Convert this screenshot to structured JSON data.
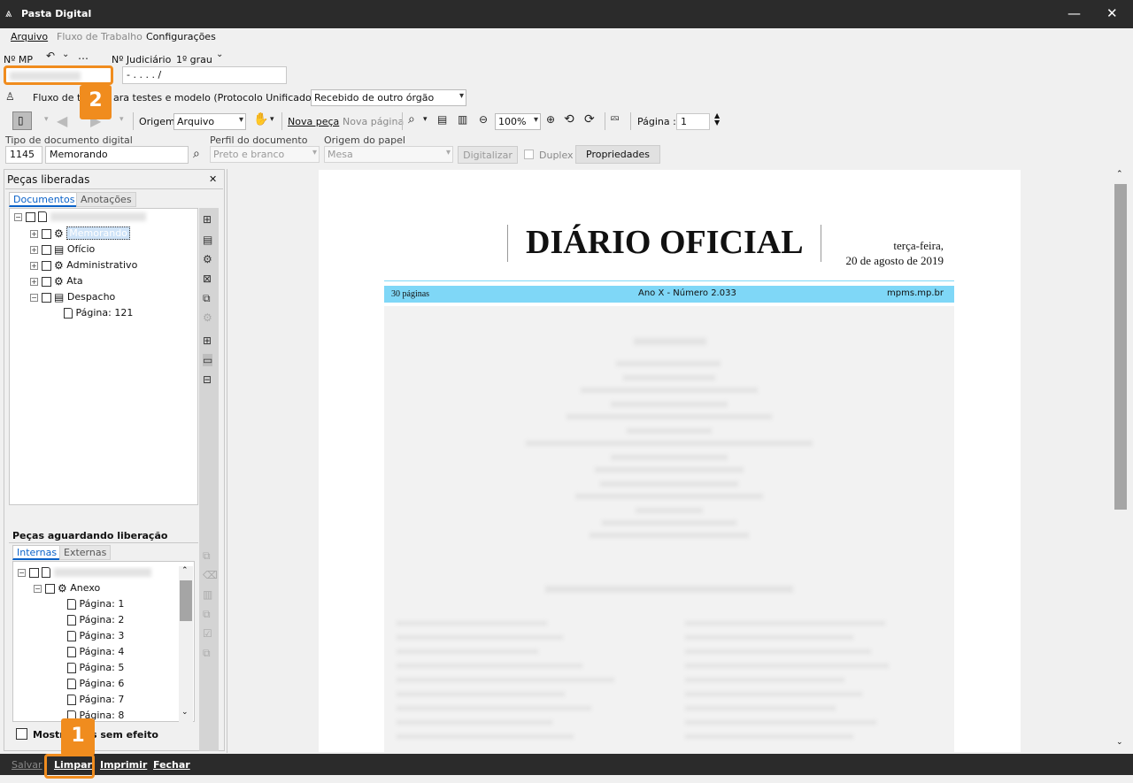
{
  "window": {
    "title": "Pasta Digital",
    "minimize": "—",
    "close": "✕"
  },
  "menu": {
    "arquivo": "Arquivo",
    "fluxo": "Fluxo de Trabalho",
    "config": "Configurações"
  },
  "header": {
    "nmp_label": "Nº MP",
    "judicial_label": "Nº Judiciário",
    "grau": "1º grau",
    "judicial_value": "-  .    .  .  .    /",
    "workflow_label": "Fluxo de tra",
    "workflow_text": "ara testes e modelo (Protocolo Unificado) - Fila",
    "fila_value": "Recebido de outro órgão"
  },
  "toolbar": {
    "origem_label": "Origem",
    "origem_value": "Arquivo",
    "nova_peca": "Nova peça",
    "nova_pagina": "Nova página",
    "zoom": "100%",
    "pagina_label": "Página :",
    "pagina_value": "1"
  },
  "docfields": {
    "tipo_label": "Tipo de documento digital",
    "tipo_code": "1145",
    "tipo_value": "Memorando",
    "perfil_label": "Perfil do documento",
    "perfil_value": "Preto e branco",
    "origem_papel_label": "Origem do papel",
    "origem_papel_value": "Mesa",
    "digitalizar": "Digitalizar",
    "duplex": "Duplex",
    "propriedades": "Propriedades"
  },
  "pecas_liberadas": {
    "title": "Peças liberadas",
    "close": "✕",
    "tab_docs": "Documentos",
    "tab_anot": "Anotações",
    "items": [
      "Memorando",
      "Ofício",
      "Administrativo",
      "Ata",
      "Despacho"
    ],
    "page_item": "Página: 121"
  },
  "pecas_aguardando": {
    "title": "Peças aguardando liberação",
    "tab_int": "Internas",
    "tab_ext": "Externas",
    "anexo": "Anexo",
    "pages": [
      "Página: 1",
      "Página: 2",
      "Página: 3",
      "Página: 4",
      "Página: 5",
      "Página: 6",
      "Página: 7",
      "Página: 8"
    ],
    "show_label": "Mostr",
    "show_label_rest": "s sem efeito"
  },
  "document": {
    "masthead": "DIÁRIO OFICIAL",
    "weekday": "terça-feira,",
    "date": "20 de agosto de 2019",
    "pages": "30 páginas",
    "issue": "Ano X - Número 2.033",
    "site": "mpms.mp.br"
  },
  "bottom": {
    "salvar": "Salvar",
    "limpar": "Limpar",
    "imprimir": "Imprimir",
    "fechar": "Fechar"
  },
  "badges": {
    "one": "1",
    "two": "2"
  },
  "colors": {
    "accent": "#f08c1e",
    "bar": "#2b2b2b",
    "doc_band": "#7fd7f7",
    "tab_blue": "#0a62c9"
  }
}
